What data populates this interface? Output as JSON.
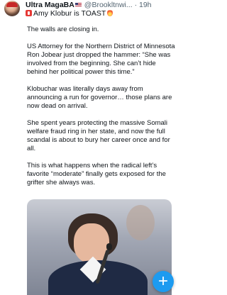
{
  "post": {
    "author_name": "Ultra MagaBA",
    "handle": "@Brookltnwi...",
    "separator": "·",
    "time": "19h",
    "headline": "Amy Klobur is TOAST",
    "avatar_icon": "user-avatar-icon",
    "badge_icons": [
      "us-flag-icon",
      "alert-siren-icon",
      "fire-icon"
    ],
    "paragraphs": [
      "The walls are closing in.",
      "US Attorney for the Northern District of Minnesota Ron Jobear just dropped the hammer: “She was involved from the beginning. She can’t hide behind her political power this time.”",
      "Klobuchar was literally days away from announcing a run for governor… those plans are now dead on arrival.",
      "She spent years protecting the massive Somali welfare fraud ring in her state, and now the full scandal is about to bury her career once and for all.",
      "This is what happens when the radical left’s favorite “moderate” finally gets exposed for the grifter she always was."
    ]
  },
  "compose_button": {
    "label": "+",
    "icon": "plus-icon",
    "color": "#1d9bf0"
  }
}
